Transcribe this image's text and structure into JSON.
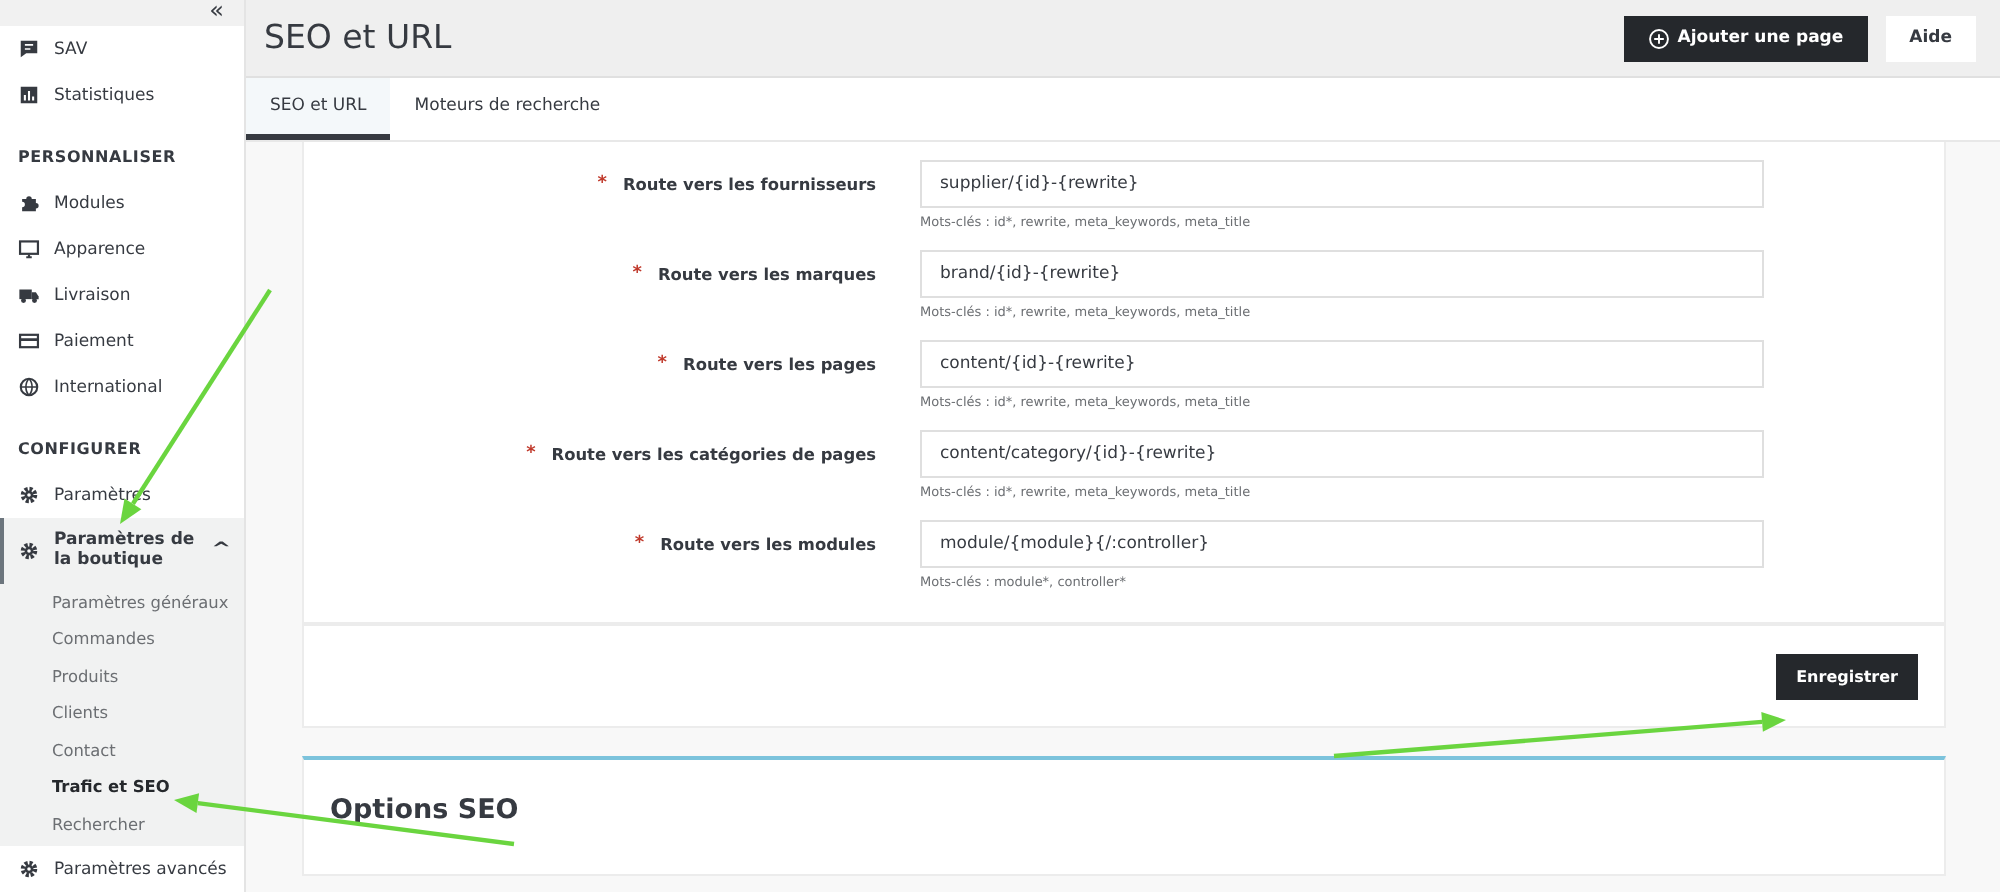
{
  "sidebar": {
    "collapse": "«",
    "items": [
      {
        "kind": "item",
        "label": "SAV",
        "selected": false
      },
      {
        "kind": "item",
        "label": "Statistiques",
        "selected": false
      },
      {
        "kind": "heading",
        "label": "PERSONNALISER"
      },
      {
        "kind": "item",
        "label": "Modules",
        "selected": false
      },
      {
        "kind": "item",
        "label": "Apparence",
        "selected": false
      },
      {
        "kind": "item",
        "label": "Livraison",
        "selected": false
      },
      {
        "kind": "item",
        "label": "Paiement",
        "selected": false
      },
      {
        "kind": "item",
        "label": "International",
        "selected": false
      },
      {
        "kind": "heading",
        "label": "CONFIGURER"
      },
      {
        "kind": "item",
        "label": "Paramètres",
        "selected": false
      },
      {
        "kind": "group",
        "label": "Paramètres de la boutique",
        "expanded": true,
        "toggle": "^",
        "children": [
          {
            "label": "Paramètres généraux",
            "selected": false
          },
          {
            "label": "Commandes",
            "selected": false
          },
          {
            "label": "Produits",
            "selected": false
          },
          {
            "label": "Clients",
            "selected": false
          },
          {
            "label": "Contact",
            "selected": false
          },
          {
            "label": "Trafic et SEO",
            "selected": true
          },
          {
            "label": "Rechercher",
            "selected": false
          }
        ]
      },
      {
        "kind": "item",
        "label": "Paramètres avancés",
        "selected": false
      }
    ]
  },
  "header": {
    "title": "SEO et URL",
    "buttons": [
      {
        "label": "Ajouter une page",
        "primary": true
      },
      {
        "label": "Aide",
        "primary": false
      }
    ]
  },
  "tabs": [
    {
      "label": "SEO et URL",
      "selected": true
    },
    {
      "label": "Moteurs de recherche",
      "selected": false
    }
  ],
  "form": {
    "rows": [
      {
        "required_mark": "*",
        "label": "Route vers les fournisseurs",
        "value": "supplier/{id}-{rewrite}",
        "hint": "Mots-clés : id*, rewrite, meta_keywords, meta_title"
      },
      {
        "required_mark": "*",
        "label": "Route vers les marques",
        "value": "brand/{id}-{rewrite}",
        "hint": "Mots-clés : id*, rewrite, meta_keywords, meta_title"
      },
      {
        "required_mark": "*",
        "label": "Route vers les pages",
        "value": "content/{id}-{rewrite}",
        "hint": "Mots-clés : id*, rewrite, meta_keywords, meta_title"
      },
      {
        "required_mark": "*",
        "label": "Route vers les catégories de pages",
        "value": "content/category/{id}-{rewrite}",
        "hint": "Mots-clés : id*, rewrite, meta_keywords, meta_title"
      },
      {
        "required_mark": "*",
        "label": "Route vers les modules",
        "value": "module/{module}{/:controller}",
        "hint": "Mots-clés : module*, controller*"
      }
    ],
    "save": "Enregistrer"
  },
  "next_section": {
    "title": "Options SEO"
  }
}
